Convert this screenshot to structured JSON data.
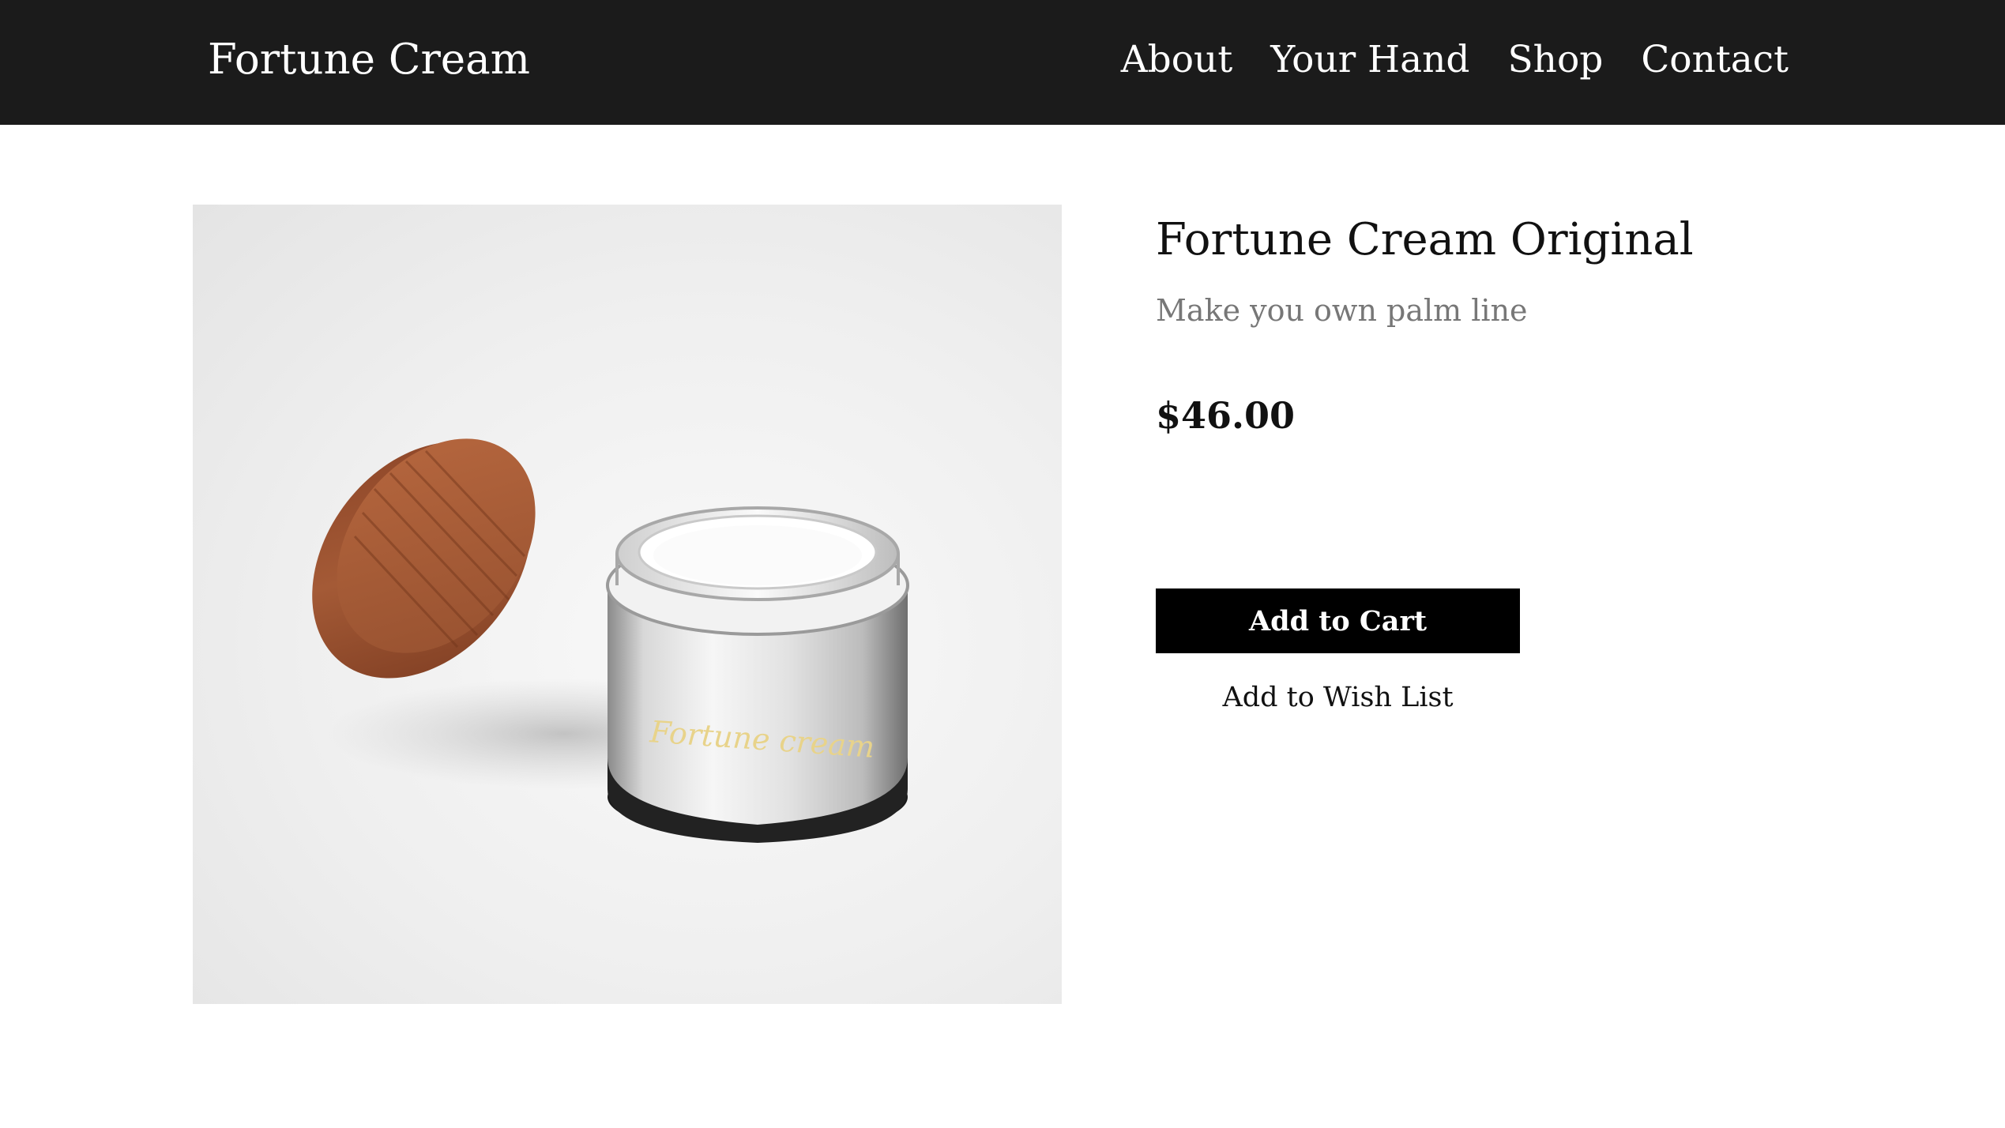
{
  "header": {
    "brand": "Fortune Cream",
    "nav": [
      "About",
      "Your Hand",
      "Shop",
      "Contact"
    ]
  },
  "product": {
    "title": "Fortune Cream Original",
    "subtitle": "Make you own palm line",
    "price": "$46.00",
    "jar_label": "Fortune cream",
    "add_to_cart": "Add to Cart",
    "add_to_wishlist": "Add to Wish List"
  },
  "colors": {
    "header_bg": "#1b1b1b",
    "button_bg": "#000000",
    "subtitle_text": "#777777",
    "lid_wood": "#a45a36",
    "label_gold": "#e8d38a"
  }
}
